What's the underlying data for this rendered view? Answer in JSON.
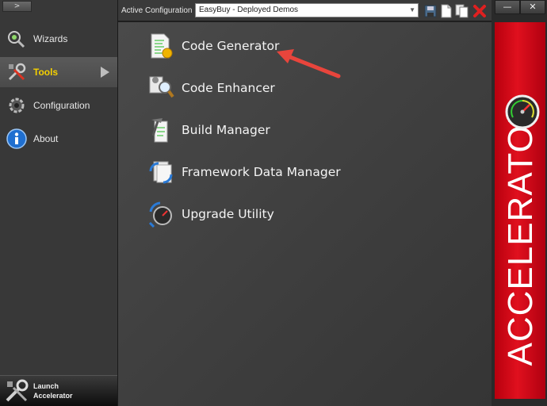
{
  "sidebar": {
    "expand_label": ">",
    "items": [
      {
        "label": "Wizards",
        "icon": "wizard-icon"
      },
      {
        "label": "Tools",
        "icon": "tools-icon",
        "active": true
      },
      {
        "label": "Configuration",
        "icon": "gear-icon"
      },
      {
        "label": "About",
        "icon": "info-icon"
      }
    ],
    "launch_label": "Launch\nAccelerator"
  },
  "topbar": {
    "config_label": "Active Configuration",
    "config_value": "EasyBuy - Deployed Demos",
    "icons": [
      "save-icon",
      "new-document-icon",
      "copy-icon",
      "delete-icon"
    ]
  },
  "tools": [
    {
      "label": "Code Generator",
      "icon": "code-generator-icon"
    },
    {
      "label": "Code Enhancer",
      "icon": "code-enhancer-icon"
    },
    {
      "label": "Build Manager",
      "icon": "build-manager-icon"
    },
    {
      "label": "Framework Data Manager",
      "icon": "framework-data-icon"
    },
    {
      "label": "Upgrade Utility",
      "icon": "upgrade-utility-icon"
    }
  ],
  "window": {
    "minimize_label": "—",
    "close_label": "✕"
  },
  "brand": {
    "text": "ACCELERATOR"
  },
  "colors": {
    "accent_red": "#d0101c",
    "active_text": "#f4d000",
    "annotation_arrow": "#e8453c"
  }
}
